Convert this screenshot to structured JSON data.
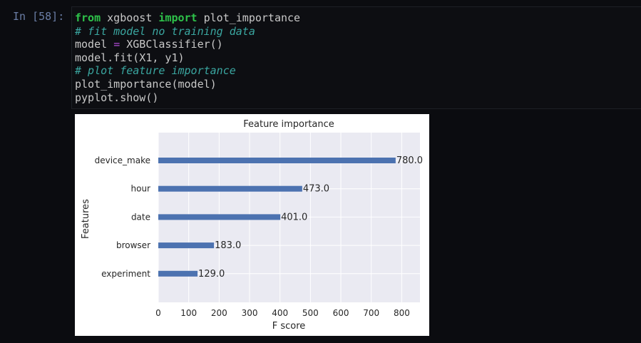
{
  "prompt_label": "In [58]:",
  "code": {
    "line1": {
      "kw1": "from",
      "mod": " xgboost ",
      "kw2": "import",
      "name": " plot_importance"
    },
    "line2": "# fit model no training data",
    "line3": {
      "lhs": "model ",
      "op": "=",
      "rhs": " XGBClassifier()"
    },
    "line4": "model.fit(X1, y1)",
    "line5": "# plot feature importance",
    "line6": "plot_importance(model)",
    "line7": "pyplot.show()"
  },
  "colors": {
    "background": "#0b0c10",
    "bar": "#4c72b0",
    "plot_bg": "#eaeaf2",
    "keyword": "#2ec24a",
    "comment": "#3aa6a0"
  },
  "chart_data": {
    "type": "bar",
    "orientation": "horizontal",
    "title": "Feature importance",
    "xlabel": "F score",
    "ylabel": "Features",
    "categories": [
      "device_make",
      "hour",
      "date",
      "browser",
      "experiment"
    ],
    "values": [
      780.0,
      473.0,
      401.0,
      183.0,
      129.0
    ],
    "value_labels": [
      "780.0",
      "473.0",
      "401.0",
      "183.0",
      "129.0"
    ],
    "xticks": [
      0,
      100,
      200,
      300,
      400,
      500,
      600,
      700,
      800
    ],
    "xlim": [
      0,
      860
    ],
    "grid": true,
    "legend": "none"
  }
}
